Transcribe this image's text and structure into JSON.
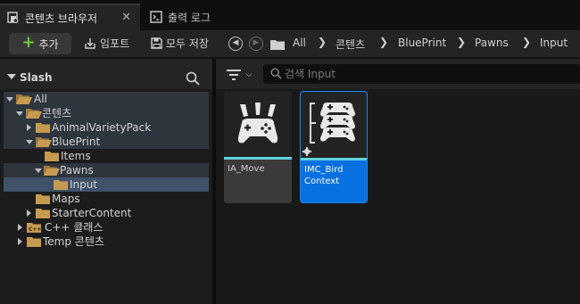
{
  "tabs": [
    {
      "label": "콘텐츠 브라우저",
      "active": true,
      "close": "✕"
    },
    {
      "label": "출력 로그",
      "active": false
    }
  ],
  "toolbar": {
    "add_label": "추가",
    "import_label": "임포트",
    "save_label": "모두 저장"
  },
  "breadcrumb": [
    "All",
    "콘텐츠",
    "BluePrint",
    "Pawns",
    "Input"
  ],
  "breadcrumb_separator": "❯",
  "sidebar": {
    "title": "Slash",
    "tree": [
      {
        "label": "All",
        "expanded": true
      },
      {
        "label": "콘텐츠",
        "expanded": true
      },
      {
        "label": "AnimalVarietyPack",
        "expanded": false
      },
      {
        "label": "BluePrint",
        "expanded": true
      },
      {
        "label": "Items"
      },
      {
        "label": "Pawns",
        "expanded": true
      },
      {
        "label": "Input",
        "selected": true
      },
      {
        "label": "Maps"
      },
      {
        "label": "StarterContent",
        "expanded": false
      },
      {
        "label": "C++ 클래스",
        "expanded": false
      },
      {
        "label": "Temp 콘텐츠",
        "expanded": false
      }
    ]
  },
  "search": {
    "placeholder": "검색 Input"
  },
  "assets": [
    {
      "name": "IA_Move",
      "icon": "gamepad-action-icon",
      "selected": false
    },
    {
      "name": "IMC_Bird Context",
      "icon": "input-mapping-context-icon",
      "selected": true
    }
  ],
  "colors": {
    "accent_blue": "#0a76e8",
    "folder": "#c79a52",
    "asset_stripe": "#5fd2dc",
    "add_plus": "#6ccf3a"
  }
}
